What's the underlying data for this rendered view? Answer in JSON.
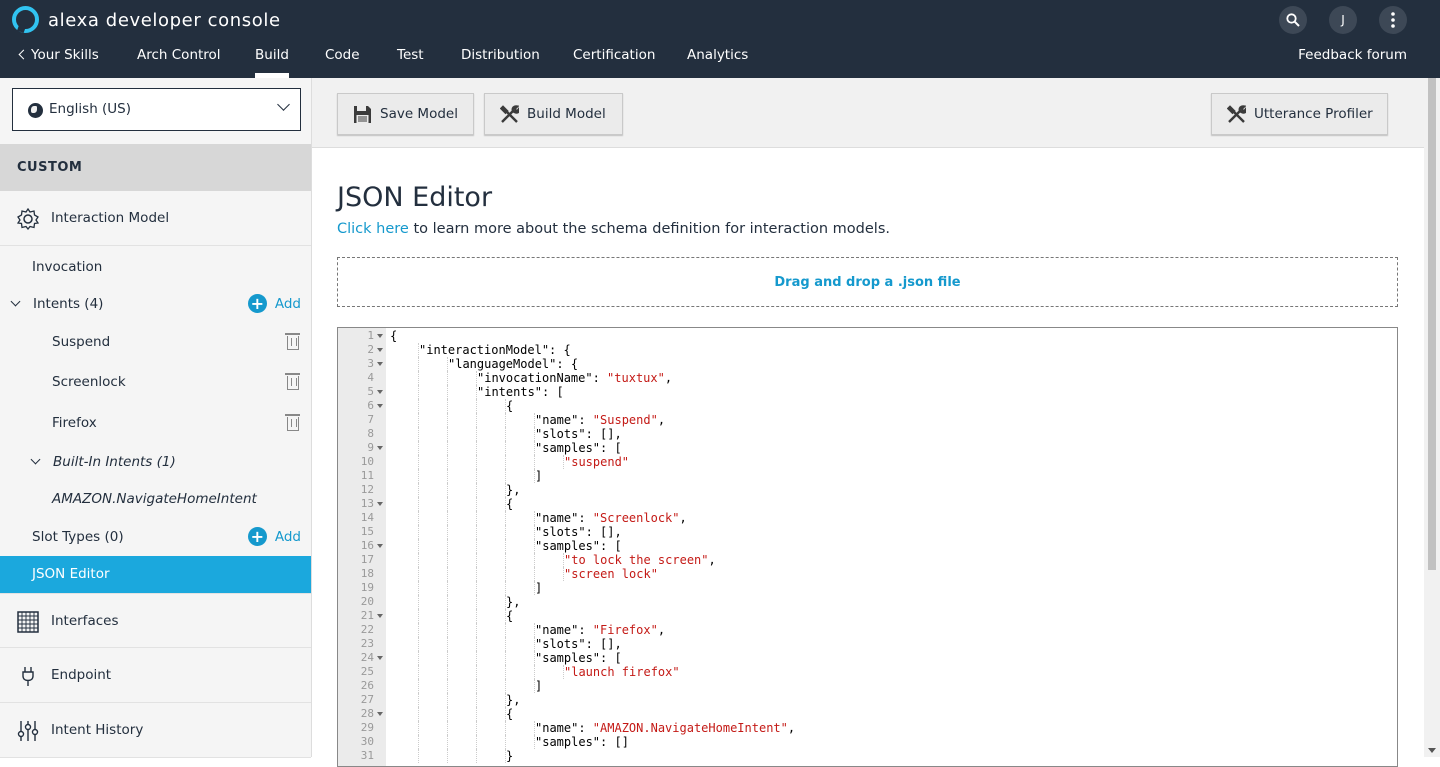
{
  "header": {
    "brand": "alexa developer console",
    "avatar_initial": "J",
    "nav": {
      "back": "Your Skills",
      "skill": "Arch Control",
      "tabs": [
        "Build",
        "Code",
        "Test",
        "Distribution",
        "Certification",
        "Analytics"
      ],
      "active_tab": "Build"
    },
    "feedback": "Feedback forum"
  },
  "sidebar": {
    "locale": "English (US)",
    "section_header": "CUSTOM",
    "interaction_model": "Interaction Model",
    "invocation": "Invocation",
    "intents_label": "Intents (4)",
    "add_label": "Add",
    "intents": [
      "Suspend",
      "Screenlock",
      "Firefox"
    ],
    "builtin_label": "Built-In Intents (1)",
    "builtin_intents": [
      "AMAZON.NavigateHomeIntent"
    ],
    "slot_types_label": "Slot Types (0)",
    "json_editor": "JSON Editor",
    "interfaces": "Interfaces",
    "endpoint": "Endpoint",
    "intent_history": "Intent History"
  },
  "toolbar": {
    "save": "Save Model",
    "build": "Build Model",
    "profiler": "Utterance Profiler"
  },
  "main": {
    "title": "JSON Editor",
    "link": "Click here",
    "link_suffix": " to learn more about the schema definition for interaction models.",
    "dropzone": "Drag and drop a .json file"
  },
  "colors": {
    "header_bg": "#232f3e",
    "accent": "#1599cd",
    "active_item": "#1ba8dd",
    "string": "#c41a16"
  },
  "editor": {
    "lines": [
      {
        "n": "1",
        "fold": true,
        "indent": 0,
        "text": "{",
        "str": ""
      },
      {
        "n": "2",
        "fold": true,
        "indent": 1,
        "text": "\"interactionModel\": {",
        "str": ""
      },
      {
        "n": "3",
        "fold": true,
        "indent": 2,
        "text": "\"languageModel\": {",
        "str": ""
      },
      {
        "n": "4",
        "fold": false,
        "indent": 3,
        "text": "\"invocationName\": ",
        "str": "\"tuxtux\"",
        "tail": ","
      },
      {
        "n": "5",
        "fold": true,
        "indent": 3,
        "text": "\"intents\": [",
        "str": ""
      },
      {
        "n": "6",
        "fold": true,
        "indent": 4,
        "text": "{",
        "str": ""
      },
      {
        "n": "7",
        "fold": false,
        "indent": 5,
        "text": "\"name\": ",
        "str": "\"Suspend\"",
        "tail": ","
      },
      {
        "n": "8",
        "fold": false,
        "indent": 5,
        "text": "\"slots\": [],",
        "str": ""
      },
      {
        "n": "9",
        "fold": true,
        "indent": 5,
        "text": "\"samples\": [",
        "str": ""
      },
      {
        "n": "10",
        "fold": false,
        "indent": 6,
        "text": "",
        "str": "\"suspend\""
      },
      {
        "n": "11",
        "fold": false,
        "indent": 5,
        "text": "]",
        "str": ""
      },
      {
        "n": "12",
        "fold": false,
        "indent": 4,
        "text": "},",
        "str": ""
      },
      {
        "n": "13",
        "fold": true,
        "indent": 4,
        "text": "{",
        "str": ""
      },
      {
        "n": "14",
        "fold": false,
        "indent": 5,
        "text": "\"name\": ",
        "str": "\"Screenlock\"",
        "tail": ","
      },
      {
        "n": "15",
        "fold": false,
        "indent": 5,
        "text": "\"slots\": [],",
        "str": ""
      },
      {
        "n": "16",
        "fold": true,
        "indent": 5,
        "text": "\"samples\": [",
        "str": ""
      },
      {
        "n": "17",
        "fold": false,
        "indent": 6,
        "text": "",
        "str": "\"to lock the screen\"",
        "tail": ","
      },
      {
        "n": "18",
        "fold": false,
        "indent": 6,
        "text": "",
        "str": "\"screen lock\""
      },
      {
        "n": "19",
        "fold": false,
        "indent": 5,
        "text": "]",
        "str": ""
      },
      {
        "n": "20",
        "fold": false,
        "indent": 4,
        "text": "},",
        "str": ""
      },
      {
        "n": "21",
        "fold": true,
        "indent": 4,
        "text": "{",
        "str": ""
      },
      {
        "n": "22",
        "fold": false,
        "indent": 5,
        "text": "\"name\": ",
        "str": "\"Firefox\"",
        "tail": ","
      },
      {
        "n": "23",
        "fold": false,
        "indent": 5,
        "text": "\"slots\": [],",
        "str": ""
      },
      {
        "n": "24",
        "fold": true,
        "indent": 5,
        "text": "\"samples\": [",
        "str": ""
      },
      {
        "n": "25",
        "fold": false,
        "indent": 6,
        "text": "",
        "str": "\"launch firefox\""
      },
      {
        "n": "26",
        "fold": false,
        "indent": 5,
        "text": "]",
        "str": ""
      },
      {
        "n": "27",
        "fold": false,
        "indent": 4,
        "text": "},",
        "str": ""
      },
      {
        "n": "28",
        "fold": true,
        "indent": 4,
        "text": "{",
        "str": ""
      },
      {
        "n": "29",
        "fold": false,
        "indent": 5,
        "text": "\"name\": ",
        "str": "\"AMAZON.NavigateHomeIntent\"",
        "tail": ","
      },
      {
        "n": "30",
        "fold": false,
        "indent": 5,
        "text": "\"samples\": []",
        "str": ""
      },
      {
        "n": "31",
        "fold": false,
        "indent": 4,
        "text": "}",
        "str": ""
      }
    ]
  }
}
